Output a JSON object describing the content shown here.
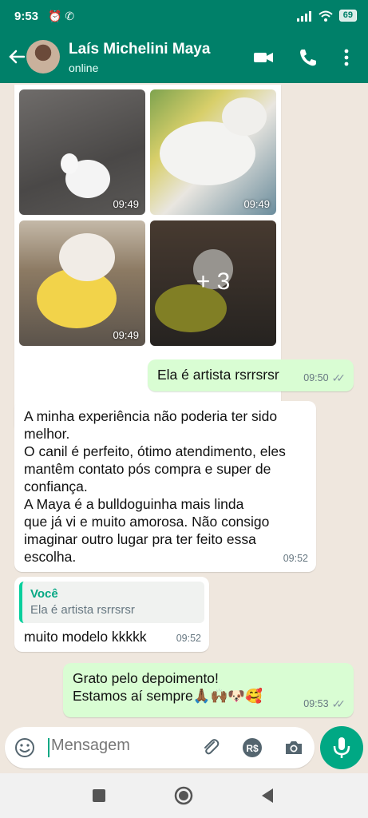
{
  "status_bar": {
    "time": "9:53",
    "left_icons": "⏰ ✆",
    "signal": "📶",
    "battery": "69"
  },
  "header": {
    "contact_name": "Laís Michelini Maya",
    "contact_status": "online",
    "icons": [
      "back-arrow-icon",
      "video-call-icon",
      "phone-icon",
      "more-options-icon"
    ]
  },
  "media": {
    "thumbs": [
      {
        "time": "09:49"
      },
      {
        "time": "09:49"
      },
      {
        "time": "09:49"
      }
    ],
    "more_count": "+ 3"
  },
  "messages": [
    {
      "dir": "out",
      "text": "Ela é artista rsrrsrsr",
      "time": "09:50",
      "ticks": "✓✓"
    },
    {
      "dir": "in",
      "lines": [
        "A minha experiência não poderia ter sido",
        "melhor.",
        "O canil é perfeito, ótimo atendimento, eles",
        "mantêm contato pós compra e super de",
        "confiança.",
        "A Maya é a bulldoguinha mais linda",
        "que já vi e muito amorosa. Não consigo",
        "imaginar outro lugar pra ter feito essa",
        "escolha."
      ],
      "time": "09:52"
    },
    {
      "dir": "in",
      "quote_author": "Você",
      "quote_text": "Ela é artista rsrrsrsr",
      "text": "muito modelo kkkkk",
      "time": "09:52"
    },
    {
      "dir": "out",
      "lines": [
        "Grato pelo depoimento!",
        "Estamos aí sempre🙏🏾🙌🏾🐶🥰"
      ],
      "time": "09:53",
      "ticks": "✓✓"
    }
  ],
  "composer": {
    "placeholder": "Mensagem",
    "icons": [
      "emoji-icon",
      "attach-icon",
      "payment-icon",
      "camera-icon",
      "mic-icon"
    ],
    "payment_label": "R$"
  },
  "colors": {
    "header": "#008069",
    "accent": "#00a884",
    "outgoing_bubble": "#d9fdd3",
    "incoming_bubble": "#ffffff",
    "chat_bg": "#efe7de"
  }
}
